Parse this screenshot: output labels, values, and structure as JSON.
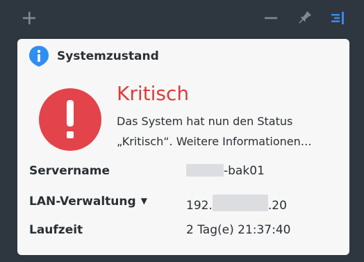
{
  "widget": {
    "title": "Systemzustand",
    "status": {
      "title": "Kritisch",
      "description": "Das System hat nun den Status „Kritisch“. Weitere Informationen…",
      "color": "#dd3b3b"
    },
    "rows": {
      "servername": {
        "label": "Servername",
        "value_suffix": "-bak01"
      },
      "lan": {
        "label": "LAN-Verwaltung",
        "value_prefix": "192.",
        "value_suffix": ".20"
      },
      "uptime": {
        "label": "Laufzeit",
        "value": "2 Tag(e) 21:37:40"
      }
    }
  },
  "icons": {
    "add": "plus-icon",
    "minimize": "minus-icon",
    "pin": "pin-icon",
    "panel": "panel-toggle-icon",
    "info": "info-icon",
    "alert": "exclamation-icon",
    "dropdown": "caret-down-icon"
  },
  "colors": {
    "background": "#2e3640",
    "card": "#f7f7f7",
    "critical": "#dd3b3b",
    "info_blue": "#2f8ff0",
    "toolbar_icon": "#7f8994",
    "panel_icon": "#3a8ae6"
  }
}
